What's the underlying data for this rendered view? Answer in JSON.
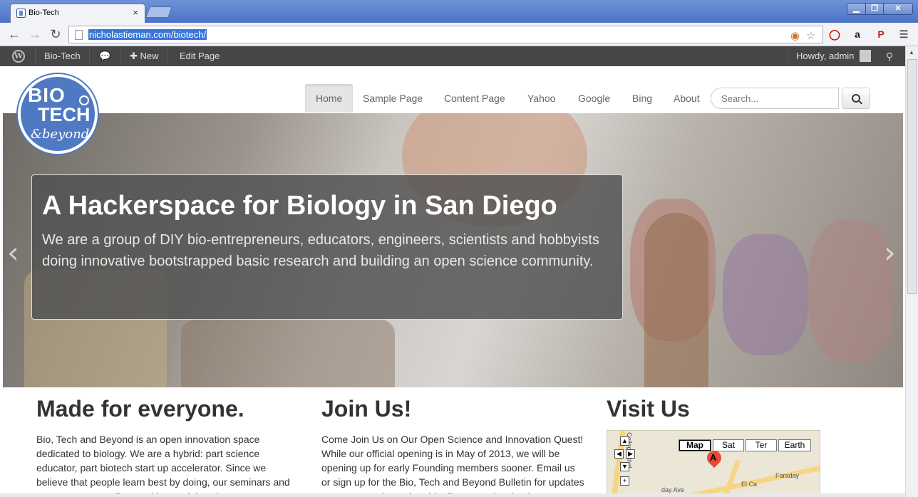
{
  "browser": {
    "tab_title": "Bio-Tech",
    "tab_close": "×",
    "url": "nicholastieman.com/biotech/",
    "win_min": "▁",
    "win_max": "❐",
    "win_close": "✕"
  },
  "adminbar": {
    "site": "Bio-Tech",
    "new_label": "New",
    "edit_page": "Edit Page",
    "howdy": "Howdy, admin"
  },
  "logo": {
    "line1": "BIO",
    "line2": "TECH",
    "line3": "&beyond"
  },
  "nav": {
    "items": [
      "Home",
      "Sample Page",
      "Content Page",
      "Yahoo",
      "Google",
      "Bing",
      "About"
    ],
    "active": "Home",
    "search_placeholder": "Search..."
  },
  "hero": {
    "title": "A Hackerspace for Biology in San Diego",
    "text": "We are a group of DIY bio-entrepreneurs, educators, engineers, scientists and hobbyists doing innovative bootstrapped basic research and building an open science community.",
    "prev": "‹",
    "next": "›"
  },
  "columns": [
    {
      "heading": "Made for everyone.",
      "text": "Bio, Tech and Beyond is an open innovation space dedicated to biology. We are a hybrid: part science educator, part biotech start up accelerator. Since we believe that people learn best by doing, our seminars and courses are complimented by wet labs where you can get"
    },
    {
      "heading": "Join Us!",
      "text": "Come Join Us on Our Open Science and Innovation Quest! While our official opening is in May of 2013, we will be opening up for early Founding members sooner. Email us or sign up for the Bio, Tech and Beyond Bulletin for updates on events and membership discounts. A calendar"
    },
    {
      "heading": "Visit Us"
    }
  ],
  "map": {
    "types": [
      "Map",
      "Sat",
      "Ter",
      "Earth"
    ],
    "active_type": "Map",
    "marker": "A",
    "labels": [
      "College Blvd",
      "Faraday",
      "day Ave",
      "El Ca"
    ]
  }
}
